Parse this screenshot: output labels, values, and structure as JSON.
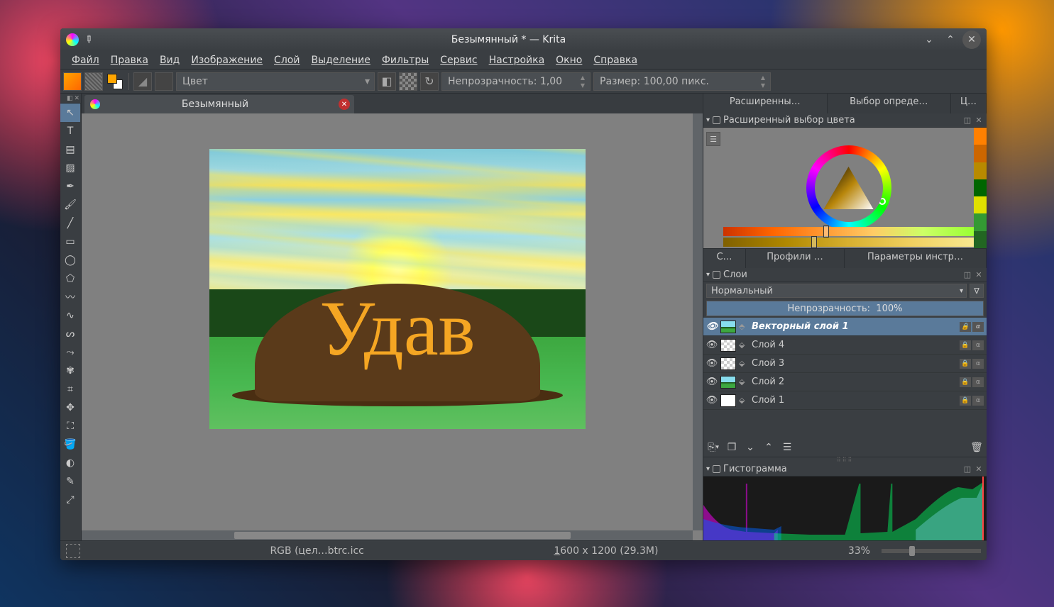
{
  "window": {
    "title": "Безымянный * — Krita"
  },
  "menu": {
    "file": "Файл",
    "edit": "Правка",
    "view": "Вид",
    "image": "Изображение",
    "layer": "Слой",
    "select": "Выделение",
    "filters": "Фильтры",
    "tools": "Сервис",
    "settings": "Настройка",
    "window": "Окно",
    "help": "Справка"
  },
  "toolbar": {
    "blend_label": "Цвет",
    "opacity_label": "Непрозрачность:",
    "opacity_value": "1,00",
    "size_label": "Размер:",
    "size_value": "100,00 пикс."
  },
  "document": {
    "tab_title": "Безымянный",
    "canvas_text": "Удав"
  },
  "right_tabs": {
    "t1": "Расширенны…",
    "t2": "Выбор опреде…",
    "t3": "Ц…"
  },
  "color_panel": {
    "title": "Расширенный выбор цвета",
    "swatches": [
      "#ff8000",
      "#cc6600",
      "#998000",
      "#006600",
      "#e0e000",
      "#339933",
      "#226622"
    ]
  },
  "mid_tabs": {
    "t1": "С…",
    "t2": "Профили …",
    "t3": "Параметры инстр…"
  },
  "layers_panel": {
    "title": "Слои",
    "blend_mode": "Нормальный",
    "opacity_label": "Непрозрачность:",
    "opacity_value": "100%",
    "layers": [
      {
        "name": "Векторный слой 1",
        "selected": true,
        "thumb": "landscape",
        "type": "vector"
      },
      {
        "name": "Слой 4",
        "selected": false,
        "thumb": "checker",
        "type": "paint"
      },
      {
        "name": "Слой 3",
        "selected": false,
        "thumb": "checker",
        "type": "paint"
      },
      {
        "name": "Слой 2",
        "selected": false,
        "thumb": "landscape",
        "type": "paint"
      },
      {
        "name": "Слой 1",
        "selected": false,
        "thumb": "white",
        "type": "paint"
      }
    ]
  },
  "histogram": {
    "title": "Гистограмма"
  },
  "status": {
    "colormodel": "RGB (цел…btrc.icc",
    "dimensions": "1600 x 1200 (29.3M)",
    "zoom": "33%"
  }
}
